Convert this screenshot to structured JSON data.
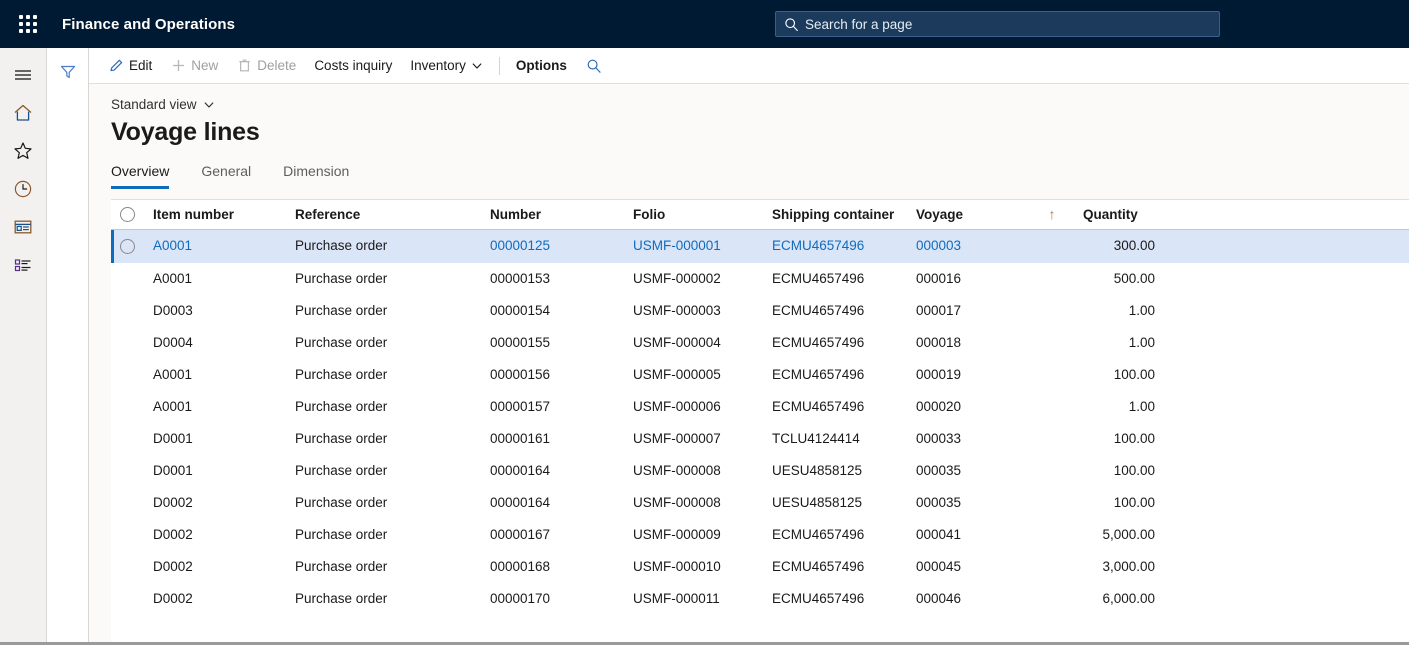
{
  "topbar": {
    "waffle_icon": "app-launcher-icon",
    "app_title": "Finance and Operations",
    "search": {
      "icon": "search-icon",
      "placeholder": "Search for a page",
      "value": ""
    }
  },
  "rail": {
    "items": [
      {
        "icon": "hamburger-menu-icon",
        "name": "expand-navigation"
      },
      {
        "icon": "home-icon",
        "name": "home"
      },
      {
        "icon": "star-icon",
        "name": "favorites"
      },
      {
        "icon": "clock-icon",
        "name": "recent"
      },
      {
        "icon": "workspace-icon",
        "name": "workspaces"
      },
      {
        "icon": "modules-list-icon",
        "name": "modules"
      }
    ]
  },
  "filter_pane": {
    "icon": "filter-funnel-icon",
    "name": "filter-pane-toggle"
  },
  "toolbar": {
    "items": [
      {
        "label": "Edit",
        "icon": "pencil-icon",
        "disabled": false,
        "strong": false
      },
      {
        "label": "New",
        "icon": "plus-icon",
        "disabled": true,
        "strong": false
      },
      {
        "label": "Delete",
        "icon": "trash-icon",
        "disabled": true,
        "strong": false
      },
      {
        "label": "Costs inquiry",
        "icon": "",
        "disabled": false,
        "strong": false
      },
      {
        "label": "Inventory",
        "icon": "",
        "disabled": false,
        "strong": false,
        "chevron": true
      }
    ],
    "options_label": "Options",
    "search_icon": "search-icon"
  },
  "page": {
    "view_selector": "Standard view",
    "view_chevron_icon": "chevron-down-icon",
    "title": "Voyage lines",
    "tabs": [
      {
        "label": "Overview",
        "active": true
      },
      {
        "label": "General",
        "active": false
      },
      {
        "label": "Dimension",
        "active": false
      }
    ]
  },
  "grid": {
    "select_all_icon": "row-select-circle-icon",
    "sort_indicator": "↑",
    "sort_column": "Voyage",
    "sort_direction": "ascending",
    "columns": [
      "Item number",
      "Reference",
      "Number",
      "Folio",
      "Shipping container",
      "Voyage",
      "Quantity"
    ],
    "rows": [
      {
        "selected": true,
        "item_number": "A0001",
        "reference": "Purchase order",
        "number": "00000125",
        "folio": "USMF-000001",
        "shipping_container": "ECMU4657496",
        "voyage": "000003",
        "quantity": "300.00"
      },
      {
        "selected": false,
        "item_number": "A0001",
        "reference": "Purchase order",
        "number": "00000153",
        "folio": "USMF-000002",
        "shipping_container": "ECMU4657496",
        "voyage": "000016",
        "quantity": "500.00"
      },
      {
        "selected": false,
        "item_number": "D0003",
        "reference": "Purchase order",
        "number": "00000154",
        "folio": "USMF-000003",
        "shipping_container": "ECMU4657496",
        "voyage": "000017",
        "quantity": "1.00"
      },
      {
        "selected": false,
        "item_number": "D0004",
        "reference": "Purchase order",
        "number": "00000155",
        "folio": "USMF-000004",
        "shipping_container": "ECMU4657496",
        "voyage": "000018",
        "quantity": "1.00"
      },
      {
        "selected": false,
        "item_number": "A0001",
        "reference": "Purchase order",
        "number": "00000156",
        "folio": "USMF-000005",
        "shipping_container": "ECMU4657496",
        "voyage": "000019",
        "quantity": "100.00"
      },
      {
        "selected": false,
        "item_number": "A0001",
        "reference": "Purchase order",
        "number": "00000157",
        "folio": "USMF-000006",
        "shipping_container": "ECMU4657496",
        "voyage": "000020",
        "quantity": "1.00"
      },
      {
        "selected": false,
        "item_number": "D0001",
        "reference": "Purchase order",
        "number": "00000161",
        "folio": "USMF-000007",
        "shipping_container": "TCLU4124414",
        "voyage": "000033",
        "quantity": "100.00"
      },
      {
        "selected": false,
        "item_number": "D0001",
        "reference": "Purchase order",
        "number": "00000164",
        "folio": "USMF-000008",
        "shipping_container": "UESU4858125",
        "voyage": "000035",
        "quantity": "100.00"
      },
      {
        "selected": false,
        "item_number": "D0002",
        "reference": "Purchase order",
        "number": "00000164",
        "folio": "USMF-000008",
        "shipping_container": "UESU4858125",
        "voyage": "000035",
        "quantity": "100.00"
      },
      {
        "selected": false,
        "item_number": "D0002",
        "reference": "Purchase order",
        "number": "00000167",
        "folio": "USMF-000009",
        "shipping_container": "ECMU4657496",
        "voyage": "000041",
        "quantity": "5,000.00"
      },
      {
        "selected": false,
        "item_number": "D0002",
        "reference": "Purchase order",
        "number": "00000168",
        "folio": "USMF-000010",
        "shipping_container": "ECMU4657496",
        "voyage": "000045",
        "quantity": "3,000.00"
      },
      {
        "selected": false,
        "item_number": "D0002",
        "reference": "Purchase order",
        "number": "00000170",
        "folio": "USMF-000011",
        "shipping_container": "ECMU4657496",
        "voyage": "000046",
        "quantity": "6,000.00"
      }
    ]
  },
  "colors": {
    "topbar_bg": "#001a33",
    "accent": "#0f6cbd",
    "selected_row_bg": "#dbe5f8",
    "rail_bg": "#f2f1f0",
    "sort_arrow": "#a8763c"
  }
}
